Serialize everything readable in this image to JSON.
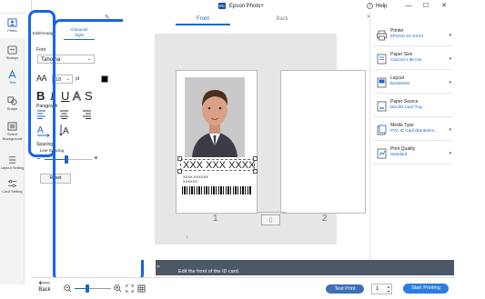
{
  "titlebar": {
    "app_title": "Epson Photo+",
    "app_logo": "PC",
    "help": "Help",
    "minimize": "—",
    "maximize": "☐",
    "close": "✕"
  },
  "leftnav": {
    "items": [
      {
        "label": "Photo",
        "icon": "photo-icon"
      },
      {
        "label": "Stamps",
        "icon": "stamps-icon"
      },
      {
        "label": "Text",
        "icon": "text-icon"
      },
      {
        "label": "Shape",
        "icon": "shape-icon"
      },
      {
        "label": "Select Background",
        "icon": "background-icon"
      },
      {
        "label": "Layout Setting",
        "icon": "layout-setting-icon"
      },
      {
        "label": "Card Setting",
        "icon": "card-setting-icon"
      }
    ]
  },
  "editpanel": {
    "tab_edit": "Edit/Arrange",
    "tab_char_line1": "Character",
    "tab_char_line2": "Style",
    "font_label": "Font",
    "font_value": "Tahoma",
    "size_value": "18",
    "size_unit": "pt",
    "paragraph_label": "Paragraph",
    "spacing_label": "Spacing",
    "line_spacing_label": "Line Spacing",
    "reset_label": "Reset",
    "bold": "B",
    "italic": "I",
    "underline": "U",
    "outline": "A",
    "strike": "S",
    "aa_label": "AA",
    "minus": "−",
    "plus": "+"
  },
  "preview": {
    "tab_front": "Front",
    "tab_back": "Back",
    "card_name": "XXX XXX XXXX",
    "card_line1": "XXXX XXXXXX",
    "card_line2": "XXXXXX",
    "page1": "1",
    "page2": "2"
  },
  "guide": {
    "text": "Edit the front of the ID card.",
    "chevron": "⌄"
  },
  "bottombar": {
    "back_label": "Back",
    "test_print": "Test Print",
    "copies": "1",
    "start_printing": "Start Printing"
  },
  "settings": [
    {
      "title": "Printer",
      "value": "EPSON XX-XXXX",
      "icon": "printer-icon"
    },
    {
      "title": "Paper Size",
      "value": "Card 54 x 86 mm",
      "icon": "paper-size-icon"
    },
    {
      "title": "Layout",
      "value": "Borderless",
      "icon": "layout-icon"
    },
    {
      "title": "Paper Source",
      "value": "Disc/ID Card Tray",
      "icon": "paper-source-icon"
    },
    {
      "title": "Media Type",
      "value": "PVC ID Card (Borderles...",
      "icon": "media-type-icon"
    },
    {
      "title": "Print Quality",
      "value": "Standard",
      "icon": "print-quality-icon"
    }
  ],
  "colors": {
    "accent": "#1b66c9",
    "highlight": "#1565e8",
    "guide_bg": "#4d5866",
    "start_btn": "#2d7ee0",
    "test_btn": "#3d6fb8"
  }
}
